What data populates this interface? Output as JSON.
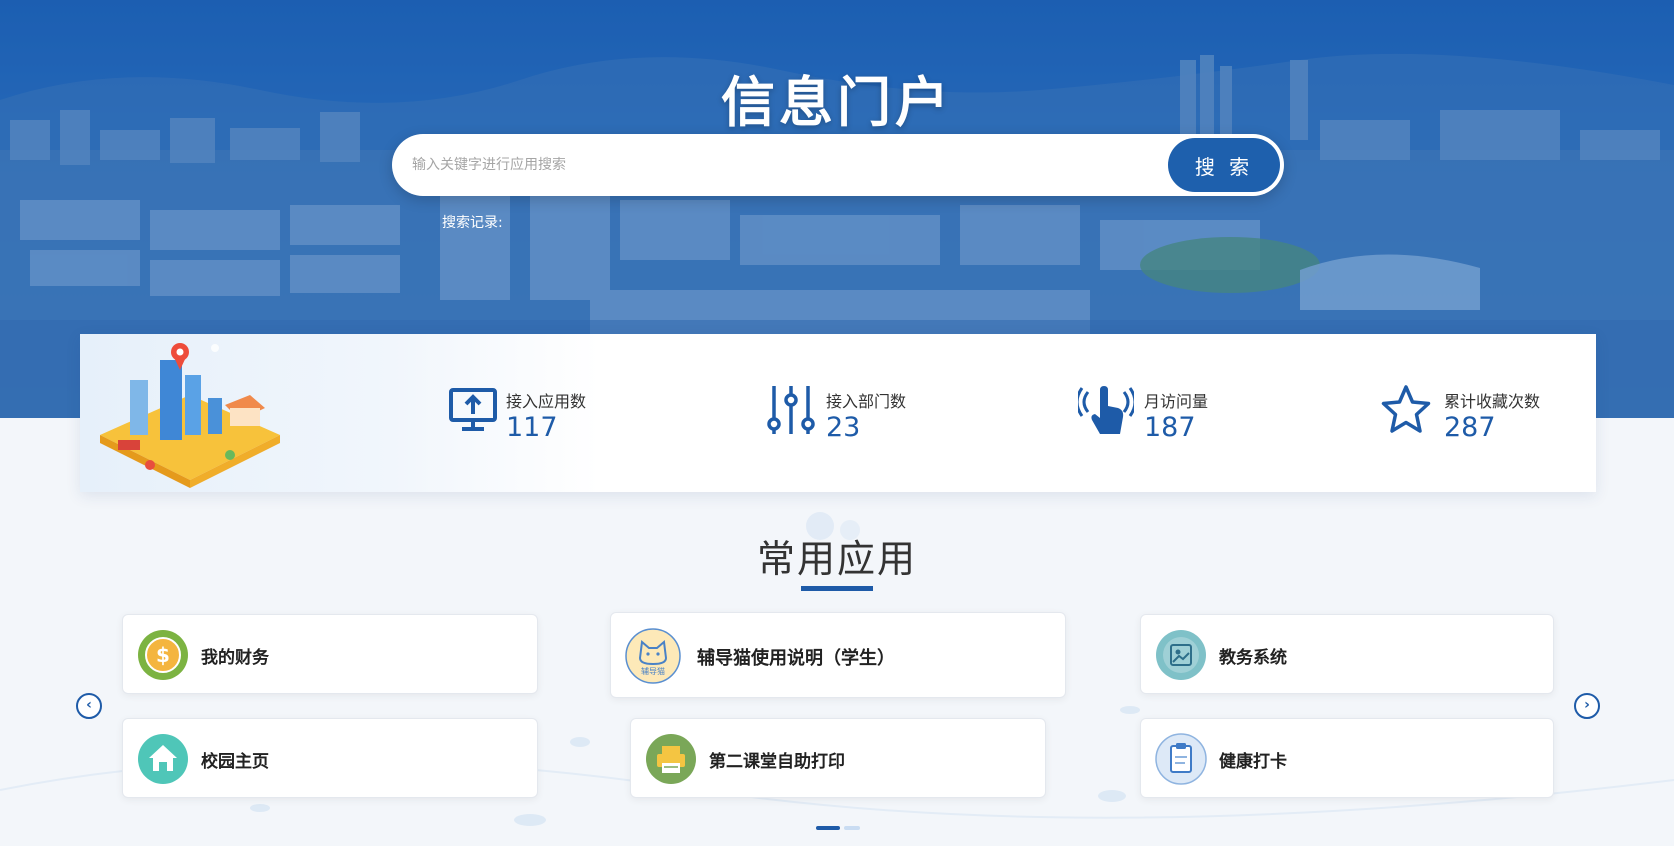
{
  "hero": {
    "title": "信息门户",
    "search": {
      "placeholder": "输入关键字进行应用搜索",
      "value": "",
      "button_label": "搜 索"
    },
    "history_label": "搜索记录:"
  },
  "stats": [
    {
      "label": "接入应用数",
      "value": "117",
      "icon": "monitor-upload-icon"
    },
    {
      "label": "接入部门数",
      "value": "23",
      "icon": "sliders-icon"
    },
    {
      "label": "月访问量",
      "value": "187",
      "icon": "touch-hand-icon"
    },
    {
      "label": "累计收藏次数",
      "value": "287",
      "icon": "star-icon"
    }
  ],
  "apps": {
    "title": "常用应用",
    "items": [
      {
        "label": "我的财务",
        "icon": "finance-coin-icon"
      },
      {
        "label": "辅导猫使用说明（学生）",
        "icon": "cat-logo-icon"
      },
      {
        "label": "教务系统",
        "icon": "academic-system-icon"
      },
      {
        "label": "校园主页",
        "icon": "home-icon"
      },
      {
        "label": "第二课堂自助打印",
        "icon": "printer-icon"
      },
      {
        "label": "健康打卡",
        "icon": "clipboard-icon"
      }
    ],
    "cat_logo_text": "辅导猫",
    "prev_icon": "chevron-left-icon",
    "next_icon": "chevron-right-icon",
    "page_count": 2,
    "active_page": 1
  },
  "colors": {
    "primary": "#1e5ba8",
    "search_button": "#1e60ad",
    "hero": "#1d64b8"
  }
}
